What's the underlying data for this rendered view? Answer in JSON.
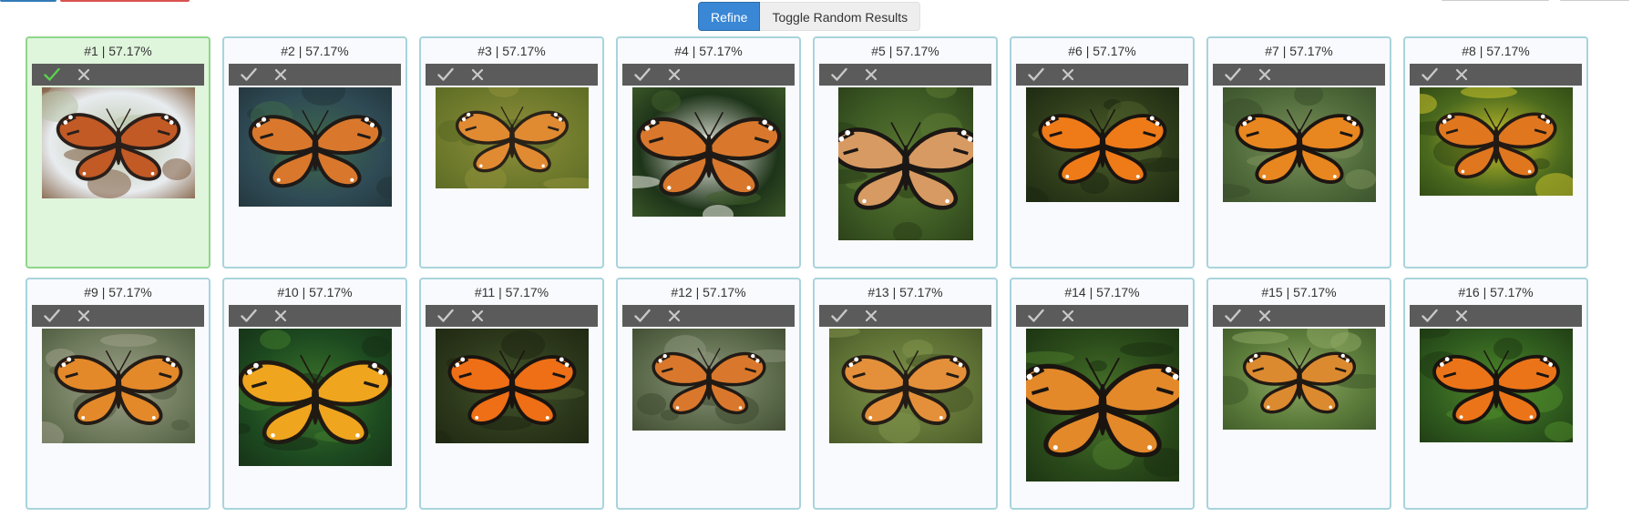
{
  "toolbar": {
    "refine_label": "Refine",
    "toggle_label": "Toggle Random Results"
  },
  "colors": {
    "accent": "#3a87d6",
    "card_border": "#a8d4dc",
    "selected_bg": "#dff5dc",
    "check_selected": "#5ad14c",
    "icon_idle": "#c8c8c8",
    "bar_bg": "#5b5b5b"
  },
  "icons": {
    "accept": "check-icon",
    "reject": "close-icon"
  },
  "results": [
    {
      "label": "#1 | 57.17%",
      "selected": true,
      "thumb": {
        "w": 168,
        "h": 122,
        "palette": [
          "#e8ecef",
          "#b7c3a6",
          "#7d5a3c",
          "#c25a26",
          "#2b1f1a"
        ],
        "dark": false
      }
    },
    {
      "label": "#2 | 57.17%",
      "selected": false,
      "thumb": {
        "w": 168,
        "h": 131,
        "palette": [
          "#2f4a55",
          "#3e6a4a",
          "#22343a",
          "#d9782c",
          "#1f1a17"
        ],
        "dark": true
      }
    },
    {
      "label": "#3 | 57.17%",
      "selected": false,
      "thumb": {
        "w": 168,
        "h": 111,
        "palette": [
          "#6f7a2c",
          "#8e8f3b",
          "#5a6a24",
          "#e08a32",
          "#2a2218"
        ],
        "dark": false
      }
    },
    {
      "label": "#4 | 57.17%",
      "selected": false,
      "thumb": {
        "w": 168,
        "h": 142,
        "palette": [
          "#1e3419",
          "#f2f2ea",
          "#3f5c2a",
          "#d9782c",
          "#201a16"
        ],
        "dark": true
      }
    },
    {
      "label": "#5 | 57.17%",
      "selected": false,
      "thumb": {
        "w": 148,
        "h": 168,
        "palette": [
          "#3d5a24",
          "#5d7a33",
          "#2a3e18",
          "#d79a62",
          "#1b1714"
        ],
        "dark": true
      }
    },
    {
      "label": "#6 | 57.17%",
      "selected": false,
      "thumb": {
        "w": 168,
        "h": 126,
        "palette": [
          "#2d3b1a",
          "#4d5f2a",
          "#1d2811",
          "#ef7a18",
          "#1a1410"
        ],
        "dark": true
      }
    },
    {
      "label": "#7 | 57.17%",
      "selected": false,
      "thumb": {
        "w": 168,
        "h": 126,
        "palette": [
          "#4f6a3a",
          "#7a8f5a",
          "#3a4f2b",
          "#e8861f",
          "#1c1511"
        ],
        "dark": false
      }
    },
    {
      "label": "#8 | 57.17%",
      "selected": false,
      "thumb": {
        "w": 168,
        "h": 119,
        "palette": [
          "#4b6a1e",
          "#c9c22a",
          "#2f4714",
          "#e0771f",
          "#231a14"
        ],
        "dark": false
      }
    },
    {
      "label": "#9 | 57.17%",
      "selected": false,
      "thumb": {
        "w": 168,
        "h": 126,
        "palette": [
          "#6e7a5b",
          "#9ea08a",
          "#4e5a3f",
          "#e3892a",
          "#241b15"
        ],
        "dark": false
      }
    },
    {
      "label": "#10 | 57.17%",
      "selected": false,
      "thumb": {
        "w": 168,
        "h": 151,
        "palette": [
          "#1d4a20",
          "#3f7a2b",
          "#163016",
          "#f0a51f",
          "#201a12"
        ],
        "dark": true
      }
    },
    {
      "label": "#11 | 57.17%",
      "selected": false,
      "thumb": {
        "w": 168,
        "h": 126,
        "palette": [
          "#2b361a",
          "#45582c",
          "#1f2712",
          "#ee6f15",
          "#1a1410"
        ],
        "dark": true
      }
    },
    {
      "label": "#12 | 57.17%",
      "selected": false,
      "thumb": {
        "w": 168,
        "h": 112,
        "palette": [
          "#5b6a4a",
          "#8a947a",
          "#3f4a32",
          "#d9782c",
          "#211a15"
        ],
        "dark": false
      }
    },
    {
      "label": "#13 | 57.17%",
      "selected": false,
      "thumb": {
        "w": 168,
        "h": 126,
        "palette": [
          "#5f7235",
          "#7f924a",
          "#475627",
          "#e4903a",
          "#241c15"
        ],
        "dark": false
      }
    },
    {
      "label": "#14 | 57.17%",
      "selected": false,
      "thumb": {
        "w": 168,
        "h": 168,
        "palette": [
          "#2a4a1a",
          "#4d7a2c",
          "#1b3212",
          "#e3892a",
          "#1a1410"
        ],
        "dark": true
      }
    },
    {
      "label": "#15 | 57.17%",
      "selected": false,
      "thumb": {
        "w": 168,
        "h": 111,
        "palette": [
          "#5a7a3a",
          "#8ea862",
          "#3f5a2a",
          "#dc8a30",
          "#211a14"
        ],
        "dark": false
      }
    },
    {
      "label": "#16 | 57.17%",
      "selected": false,
      "thumb": {
        "w": 168,
        "h": 125,
        "palette": [
          "#2f5a1e",
          "#4f8a2a",
          "#1f3a14",
          "#ec7418",
          "#1a1410"
        ],
        "dark": true
      }
    }
  ]
}
